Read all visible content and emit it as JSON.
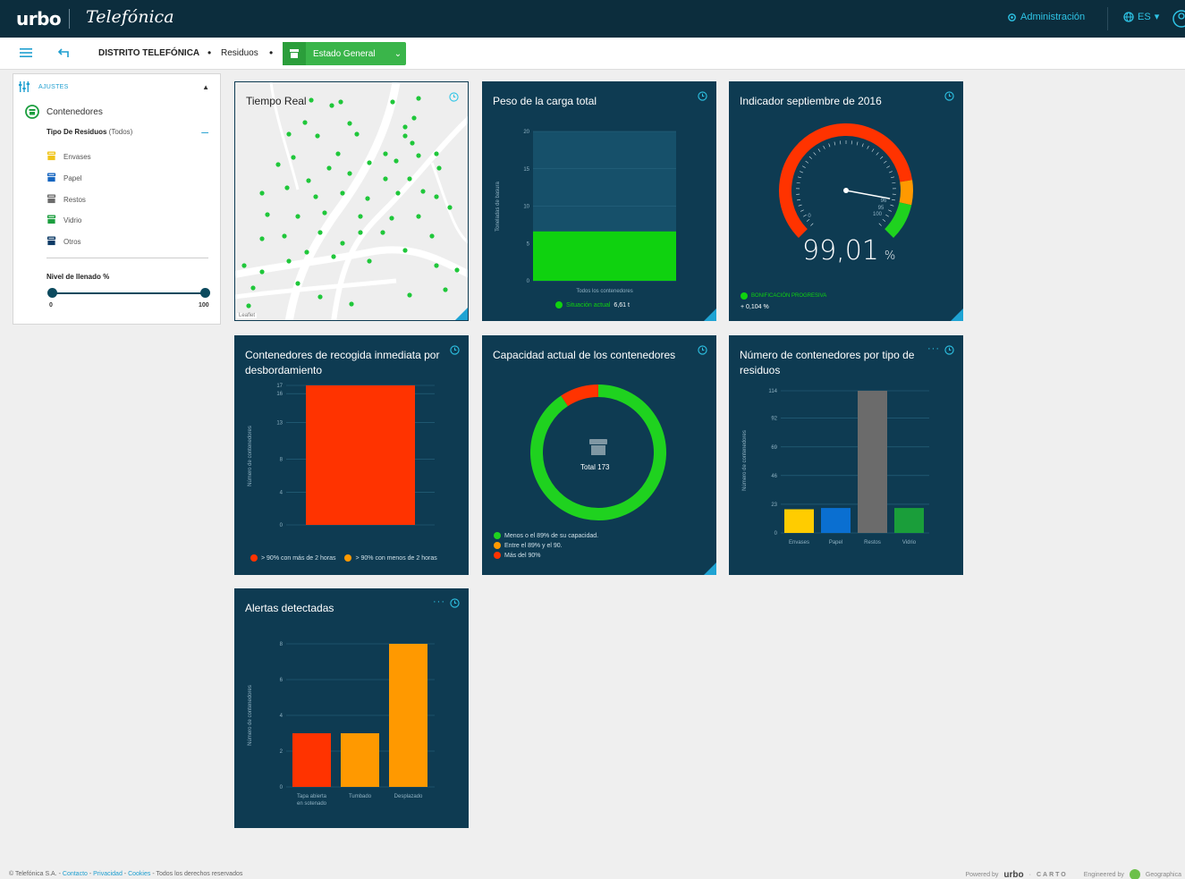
{
  "topbar": {
    "logo": "urbo",
    "brand": "Telefónica",
    "admin_label": "Administración",
    "lang_label": "ES"
  },
  "breadcrumb": {
    "district": "DISTRITO TELEFÓNICA",
    "section": "Residuos",
    "view": "Estado General"
  },
  "filters": {
    "header": "AJUSTES",
    "category": "Contenedores",
    "tipo_label": "Tipo De Residuos",
    "tipo_value": "(Todos)",
    "items": [
      {
        "label": "Envases",
        "color": "#f0c419"
      },
      {
        "label": "Papel",
        "color": "#1565c0"
      },
      {
        "label": "Restos",
        "color": "#6b6b6b"
      },
      {
        "label": "Vidrio",
        "color": "#1b9e3e"
      },
      {
        "label": "Otros",
        "color": "#0d3b66"
      }
    ],
    "nivel_label": "Nivel de llenado %",
    "slider_min": "0",
    "slider_max": "100"
  },
  "widgets": {
    "map": {
      "title": "Tiempo Real",
      "attribution": "Leaflet"
    },
    "peso": {
      "title": "Peso de la carga total",
      "ylabel": "Toneladas de basura",
      "category": "Todos los contenedores",
      "legend": "Situación actual",
      "legend_value": "6,61 t"
    },
    "indicador": {
      "title": "Indicador septiembre de 2016",
      "value_text": "99,01",
      "value_unit": "%",
      "gauge_min": "0",
      "gauge_max": "100",
      "gauge_95": "95",
      "gauge_96": "96",
      "legend": "BONIFICACIÓN PROGRESIVA",
      "delta": "+ 0,104 %"
    },
    "desbordamiento": {
      "title": "Contenedores de recogida inmediata por desbordamiento",
      "ylabel": "Número de contenedores",
      "legend_a": "> 90% con más de 2 horas",
      "legend_b": "> 90% con menos de 2 horas"
    },
    "capacidad": {
      "title": "Capacidad actual de los contenedores",
      "center": "Total 173",
      "legend_1": "Menos o el 89% de su capacidad.",
      "legend_2": "Entre el 89% y el 90.",
      "legend_3": "Más del 90%"
    },
    "tipo": {
      "title": "Número de contenedores por tipo de residuos",
      "ylabel": "Número de contenedores"
    },
    "alertas": {
      "title": "Alertas detectadas",
      "ylabel": "Número de contenedores"
    }
  },
  "chart_data": [
    {
      "type": "bar",
      "title": "Peso de la carga total",
      "ylabel": "Toneladas de basura",
      "categories": [
        "Todos los contenedores"
      ],
      "values": [
        6.61
      ],
      "ylim": [
        0,
        20
      ],
      "yticks": [
        "0",
        "5",
        "10",
        "15",
        "20"
      ],
      "color": "#0fd20f"
    },
    {
      "type": "gauge",
      "title": "Indicador septiembre de 2016",
      "value": 99.01,
      "range": [
        0,
        100
      ]
    },
    {
      "type": "bar",
      "title": "Contenedores de recogida inmediata por desbordamiento",
      "ylabel": "Número de contenedores",
      "series": [
        {
          "name": "> 90% con más de 2 horas",
          "values": [
            17
          ],
          "color": "#ff3300"
        },
        {
          "name": "> 90% con menos de 2 horas",
          "values": [
            0
          ],
          "color": "#ff9900"
        }
      ],
      "ylim": [
        0,
        17
      ],
      "yticks": [
        "0",
        "4",
        "8",
        "13",
        "16",
        "17"
      ]
    },
    {
      "type": "pie",
      "title": "Capacidad actual de los contenedores",
      "total": 173,
      "values": [
        {
          "name": "Menos o el 89% de su capacidad.",
          "value": 157,
          "color": "#1fd21f"
        },
        {
          "name": "Entre el 89% y el 90.",
          "value": 0,
          "color": "#ff9900"
        },
        {
          "name": "Más del 90%",
          "value": 16,
          "color": "#ff3300"
        }
      ]
    },
    {
      "type": "bar",
      "title": "Número de contenedores por tipo de residuos",
      "ylabel": "Número de contenedores",
      "categories": [
        "Envases",
        "Papel",
        "Restos",
        "Vidrio"
      ],
      "values": [
        19,
        20,
        114,
        20
      ],
      "colors": [
        "#ffcc00",
        "#0a6fd1",
        "#6b6b6b",
        "#1a9e3a"
      ],
      "ylim": [
        0,
        114
      ],
      "yticks": [
        "0",
        "23",
        "46",
        "69",
        "92",
        "114"
      ]
    },
    {
      "type": "bar",
      "title": "Alertas detectadas",
      "ylabel": "Número de contenedores",
      "categories": [
        "Tapa abierta en sotenado",
        "Tumbado",
        "Desplazado"
      ],
      "values": [
        3,
        3,
        8
      ],
      "colors": [
        "#ff3300",
        "#ff9900",
        "#ff9900"
      ],
      "ylim": [
        0,
        8
      ],
      "yticks": [
        "0",
        "2",
        "4",
        "6",
        "8"
      ]
    }
  ],
  "footer": {
    "copyright": "© Telefónica S.A. - ",
    "contacto": "Contacto",
    "privacidad": "Privacidad",
    "cookies": "Cookies",
    "rights": " - Todos los derechos reservados",
    "powered": "Powered by",
    "powered_logo": "urbo",
    "carto": "CARTO",
    "engineered": "Engineered by",
    "geographica": "Geographica"
  }
}
